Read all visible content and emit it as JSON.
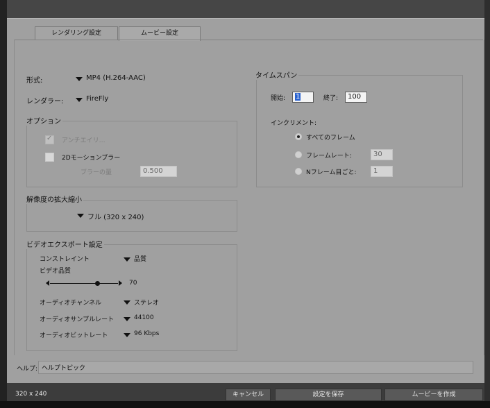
{
  "tabs": [
    {
      "label": "レンダリング設定",
      "active": false
    },
    {
      "label": "ムービー設定",
      "active": true
    }
  ],
  "left": {
    "format_label": "形式:",
    "format_value": "MP4 (H.264-AAC)",
    "renderer_label": "レンダラー:",
    "renderer_value": "FireFly",
    "options": {
      "legend": "オプション",
      "antialias_label": "アンチエイリ…",
      "motion_blur_label": "2Dモーションブラー",
      "blur_amount_label": "ブラーの量",
      "blur_amount_value": "0.500"
    },
    "resolution": {
      "legend": "解像度の拡大縮小",
      "value": "フル (320 x 240)"
    },
    "video_export": {
      "legend": "ビデオエクスポート設定",
      "constraint_label": "コンストレイント",
      "constraint_value": "品質",
      "video_quality_label": "ビデオ品質",
      "video_quality_value": "70",
      "video_quality_fraction": 0.7,
      "audio_channel_label": "オーディオチャンネル",
      "audio_channel_value": "ステレオ",
      "audio_sample_rate_label": "オーディオサンプルレート",
      "audio_sample_rate_value": "44100",
      "audio_bitrate_label": "オーディオビットレート",
      "audio_bitrate_value": "96 Kbps"
    }
  },
  "timespan": {
    "legend": "タイムスパン",
    "start_label": "開始:",
    "start_value": "1",
    "end_label": "終了:",
    "end_value": "100",
    "increment_label": "インクリメント:",
    "all_frames_label": "すべてのフレーム",
    "frame_rate_label": "フレームレート:",
    "frame_rate_value": "30",
    "nth_frame_label": "Nフレーム目ごと:",
    "nth_frame_value": "1"
  },
  "help": {
    "label": "ヘルプ:",
    "value": "ヘルプトピック"
  },
  "footer": {
    "size_label": "320 x 240",
    "cancel_label": "キャンセル",
    "save_label": "設定を保存",
    "create_label": "ムービーを作成"
  }
}
